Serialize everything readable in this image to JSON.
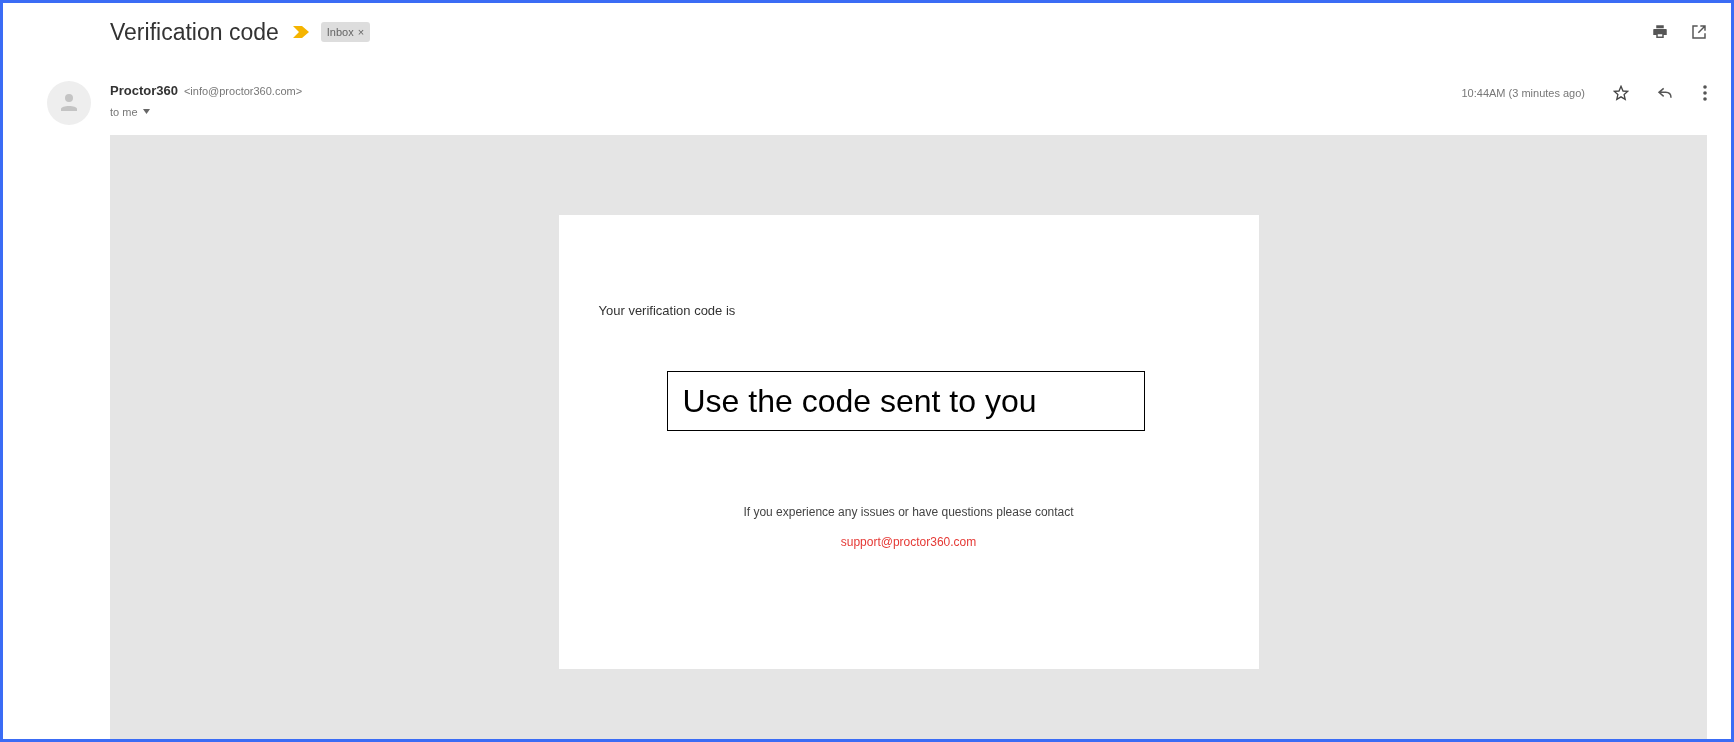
{
  "subject": "Verification code",
  "labels": [
    {
      "text": "Inbox",
      "close": "×"
    }
  ],
  "sender": {
    "name": "Proctor360",
    "email": "<info@proctor360.com>",
    "to": "to me"
  },
  "time": "10:44AM (3 minutes ago)",
  "starred": false,
  "body": {
    "intro": "Your verification code is",
    "note": "Use the code sent to you",
    "footer": "If you experience any issues or have questions please contact",
    "link": "support@proctor360.com"
  }
}
